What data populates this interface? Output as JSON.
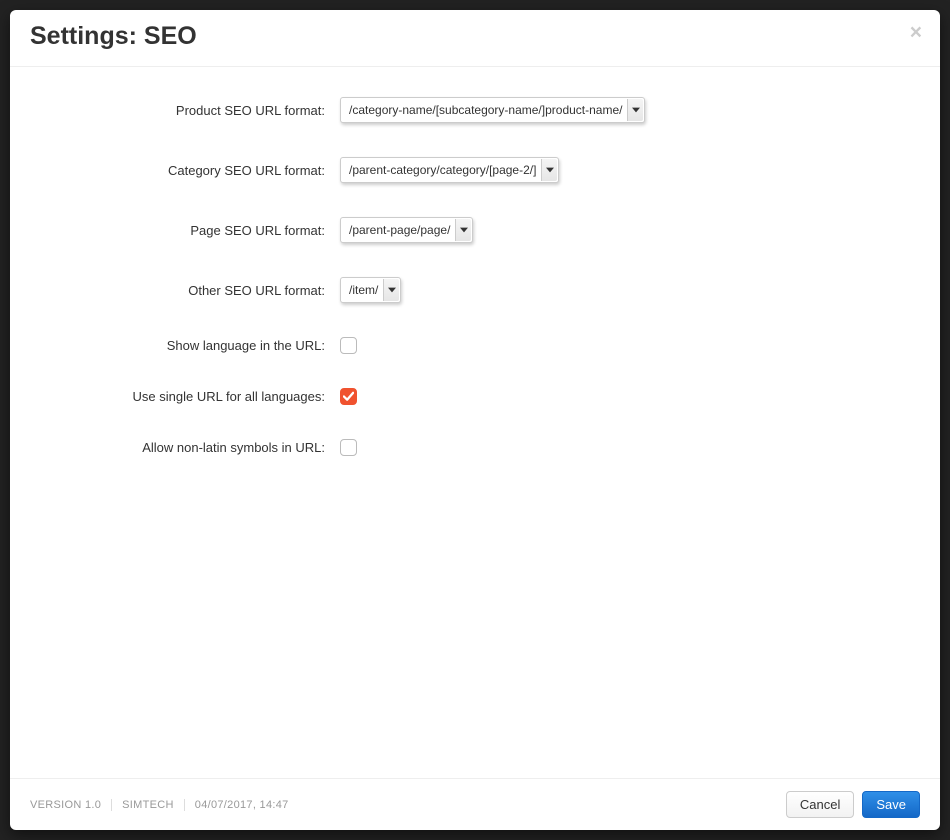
{
  "modal": {
    "title": "Settings: SEO",
    "fields": [
      {
        "label": "Product SEO URL format:",
        "selected": "/category-name/[subcategory-name/]product-name/"
      },
      {
        "label": "Category SEO URL format:",
        "selected": "/parent-category/category/[page-2/]"
      },
      {
        "label": "Page SEO URL format:",
        "selected": "/parent-page/page/"
      },
      {
        "label": "Other SEO URL format:",
        "selected": "/item/"
      }
    ],
    "checkboxes": [
      {
        "label": "Show language in the URL:",
        "checked": false
      },
      {
        "label": "Use single URL for all languages:",
        "checked": true
      },
      {
        "label": "Allow non-latin symbols in URL:",
        "checked": false
      }
    ]
  },
  "footer": {
    "version": "VERSION 1.0",
    "vendor": "SIMTECH",
    "datetime": "04/07/2017, 14:47",
    "cancel": "Cancel",
    "save": "Save"
  }
}
